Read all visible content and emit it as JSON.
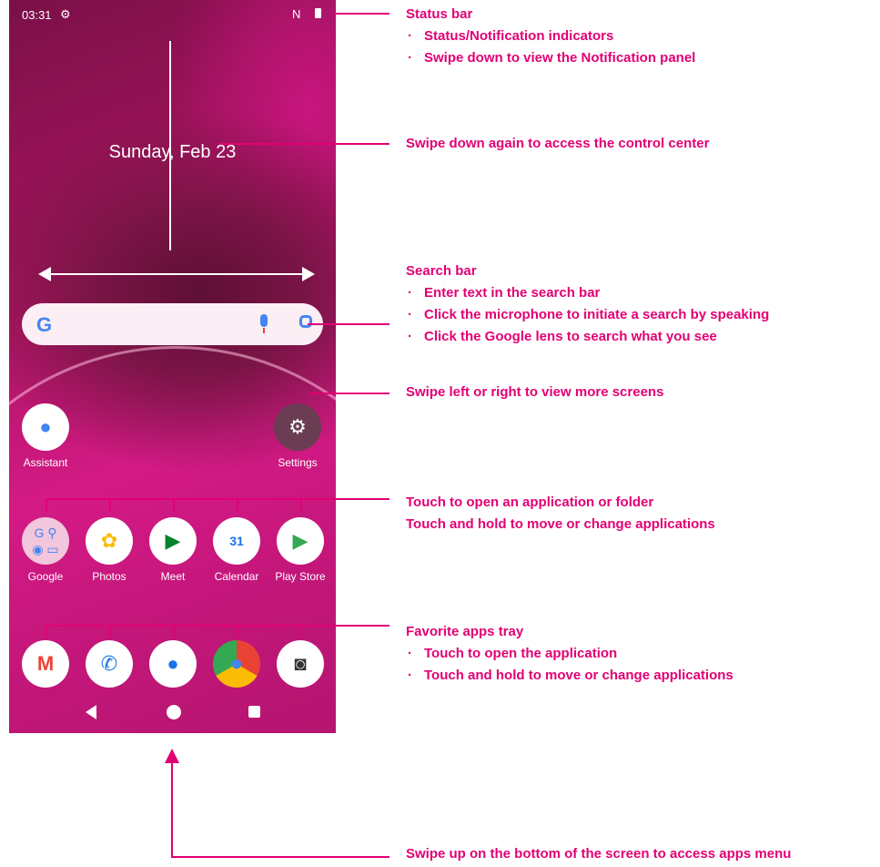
{
  "status": {
    "time": "03:31",
    "settings_icon": "gear-icon",
    "nfc_icon": "nfc-icon",
    "battery_icon": "battery-icon"
  },
  "home": {
    "date": "Sunday, Feb 23"
  },
  "search": {
    "logo": "G",
    "mic_icon": "mic-icon",
    "lens_icon": "lens-icon"
  },
  "apps_row1": [
    {
      "label": "Assistant",
      "icon": "assistant-icon"
    },
    {
      "label": "Settings",
      "icon": "gear-icon"
    }
  ],
  "apps_row2": [
    {
      "label": "Google",
      "icon": "google-folder-icon"
    },
    {
      "label": "Photos",
      "icon": "photos-icon"
    },
    {
      "label": "Meet",
      "icon": "meet-icon"
    },
    {
      "label": "Calendar",
      "icon": "calendar-icon",
      "badge": "31"
    },
    {
      "label": "Play Store",
      "icon": "play-store-icon"
    }
  ],
  "dock": [
    {
      "icon": "gmail-icon",
      "glyph": "M"
    },
    {
      "icon": "phone-icon",
      "glyph": "✆"
    },
    {
      "icon": "messages-icon",
      "glyph": "💬"
    },
    {
      "icon": "chrome-icon",
      "glyph": "◉"
    },
    {
      "icon": "camera-icon",
      "glyph": "📷"
    }
  ],
  "annotations": {
    "status_bar": {
      "title": "Status bar",
      "bullets": [
        "Status/Notification indicators",
        "Swipe down to view the Notification panel"
      ]
    },
    "control_center": "Swipe down again to access the control center",
    "search_bar": {
      "title": "Search bar",
      "bullets": [
        "Enter text in the search bar",
        "Click the microphone to initiate a search by speaking",
        "Click the Google lens to search what you see"
      ]
    },
    "swipe_screens": "Swipe left or right to view more screens",
    "apps": {
      "line1": "Touch to open an application or folder",
      "line2": "Touch and hold to move or change applications"
    },
    "favorites": {
      "title": "Favorite apps tray",
      "bullets": [
        "Touch to open the application",
        "Touch and hold to move or change applications"
      ]
    },
    "apps_menu": "Swipe up on the bottom of the screen to access apps menu"
  },
  "colors": {
    "accent": "#e20074",
    "wallpaper": "#c3167a"
  }
}
